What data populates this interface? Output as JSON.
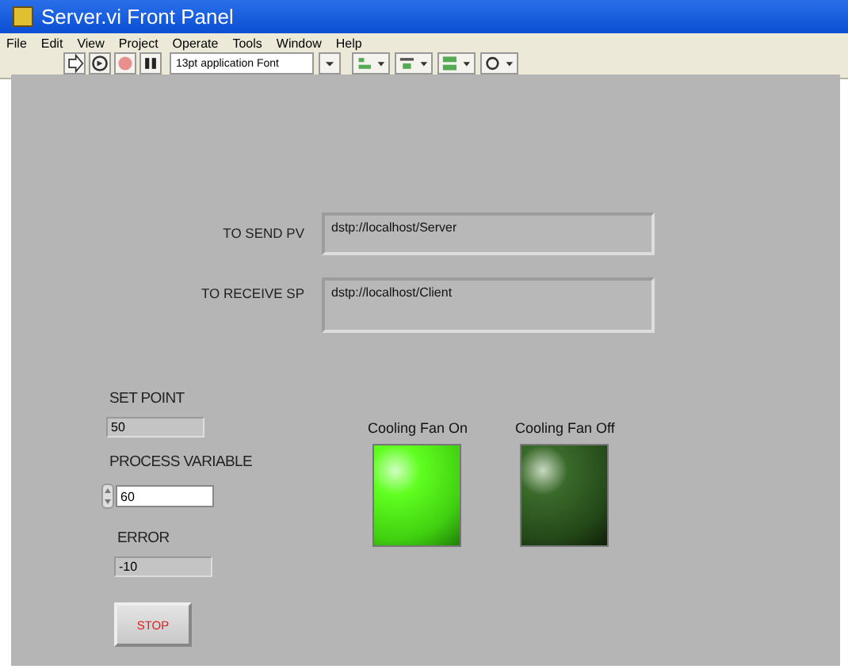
{
  "window": {
    "title": "Server.vi Front Panel"
  },
  "menu": [
    "File",
    "Edit",
    "View",
    "Project",
    "Operate",
    "Tools",
    "Window",
    "Help"
  ],
  "toolbar": {
    "font": "13pt application Font"
  },
  "strings": [
    {
      "label": "TO SEND PV",
      "value": "dstp://localhost/Server"
    },
    {
      "label": "TO RECEIVE SP",
      "value": "dstp://localhost/Client"
    }
  ],
  "numerics": [
    {
      "label": "SET POINT",
      "value": "50",
      "kind": "indicator"
    },
    {
      "label": "PROCESS VARIABLE",
      "value": "60",
      "kind": "control"
    },
    {
      "label": "ERROR",
      "value": "-10",
      "kind": "indicator"
    }
  ],
  "stop_button": {
    "label": "STOP"
  },
  "leds": [
    {
      "label": "Cooling Fan On",
      "on": true
    },
    {
      "label": "Cooling Fan Off",
      "on": false
    }
  ]
}
